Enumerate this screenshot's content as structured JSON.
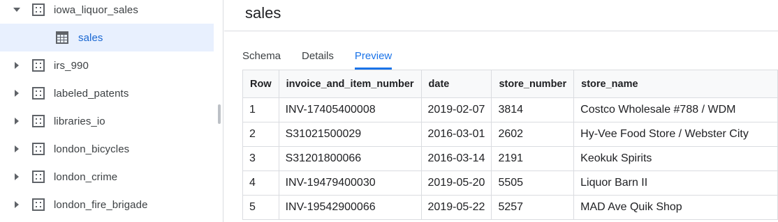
{
  "sidebar": {
    "items": [
      {
        "label": "iowa_liquor_sales",
        "expanded": true,
        "icon": "dataset-icon"
      },
      {
        "label": "sales",
        "child": true,
        "selected": true,
        "icon": "table-icon"
      },
      {
        "label": "irs_990",
        "expanded": false,
        "icon": "dataset-icon"
      },
      {
        "label": "labeled_patents",
        "expanded": false,
        "icon": "dataset-icon"
      },
      {
        "label": "libraries_io",
        "expanded": false,
        "icon": "dataset-icon"
      },
      {
        "label": "london_bicycles",
        "expanded": false,
        "icon": "dataset-icon"
      },
      {
        "label": "london_crime",
        "expanded": false,
        "icon": "dataset-icon"
      },
      {
        "label": "london_fire_brigade",
        "expanded": false,
        "icon": "dataset-icon"
      }
    ]
  },
  "main": {
    "title": "sales",
    "tabs": [
      {
        "label": "Schema",
        "active": false
      },
      {
        "label": "Details",
        "active": false
      },
      {
        "label": "Preview",
        "active": true
      }
    ],
    "table": {
      "headers": [
        "Row",
        "invoice_and_item_number",
        "date",
        "store_number",
        "store_name"
      ],
      "rows": [
        [
          "1",
          "INV-17405400008",
          "2019-02-07",
          "3814",
          "Costco Wholesale #788 / WDM"
        ],
        [
          "2",
          "S31021500029",
          "2016-03-01",
          "2602",
          "Hy-Vee Food Store / Webster City"
        ],
        [
          "3",
          "S31201800066",
          "2016-03-14",
          "2191",
          "Keokuk Spirits"
        ],
        [
          "4",
          "INV-19479400030",
          "2019-05-20",
          "5505",
          "Liquor Barn II"
        ],
        [
          "5",
          "INV-19542900066",
          "2019-05-22",
          "5257",
          "MAD Ave Quik Shop"
        ]
      ]
    }
  },
  "colors": {
    "accent": "#1a73e8",
    "selected_bg": "#e8f0fe",
    "border": "#dadce0"
  }
}
